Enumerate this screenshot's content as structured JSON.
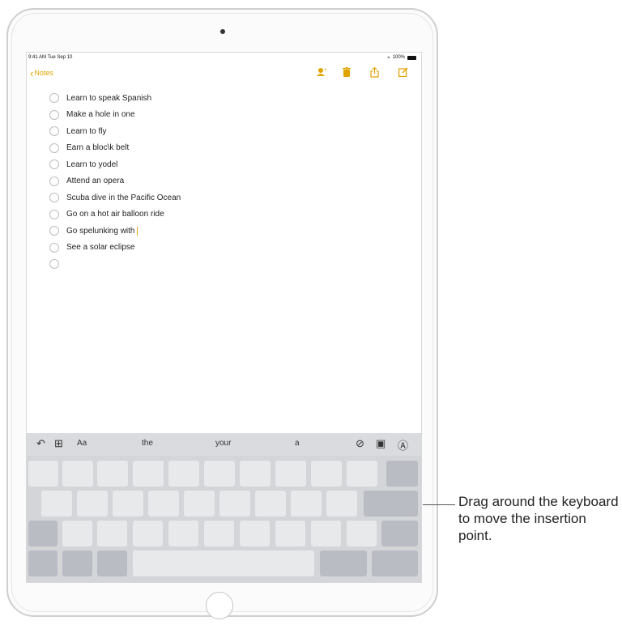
{
  "status": {
    "time_date": "9:41 AM  Tue Sep 10",
    "battery_text": "100%",
    "wifi_icon": "wifi-icon"
  },
  "nav": {
    "back_label": "Notes",
    "accent": "#e0a400"
  },
  "checklist": [
    "Learn to speak Spanish",
    "Make a hole in one",
    "Learn to fly",
    "Earn a bloc\\k belt",
    "Learn to yodel",
    "Attend an opera",
    "Scuba dive in the Pacific Ocean",
    "Go on a hot air balloon ride",
    "Go spelunking with",
    "See a solar eclipse",
    ""
  ],
  "shortcut_bar": {
    "format_label": "Aa",
    "suggestions": [
      "the",
      "your",
      "a"
    ]
  },
  "callout": {
    "text": "Drag around the keyboard to move the insertion point."
  }
}
